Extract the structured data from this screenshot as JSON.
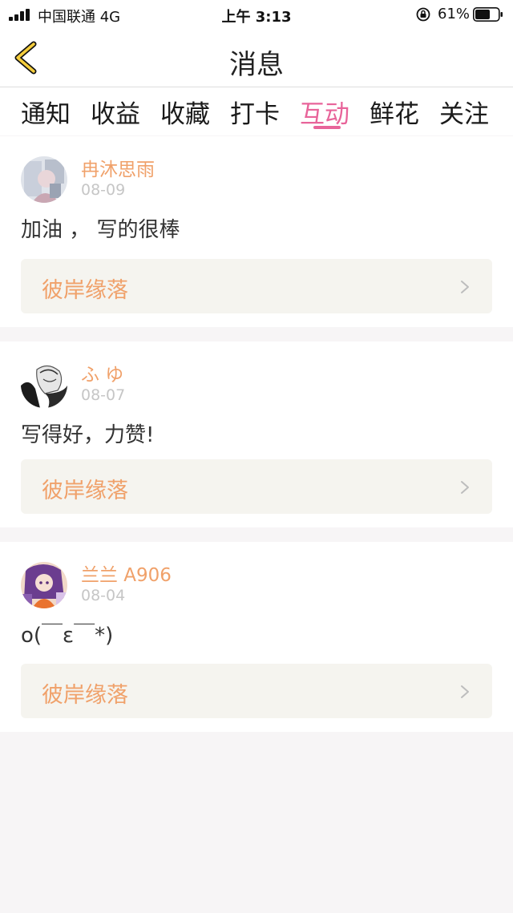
{
  "colors": {
    "accent": "#e8649a",
    "name": "#f0a16a",
    "link": "#f0a16a"
  },
  "statusbar": {
    "carrier": "中国联通  4G",
    "time": "上午 3:13",
    "battery": "61%"
  },
  "header": {
    "title": "消息",
    "back_icon": "chevron-left-icon"
  },
  "tabs": [
    {
      "label": "通知"
    },
    {
      "label": "收益"
    },
    {
      "label": "收藏"
    },
    {
      "label": "打卡"
    },
    {
      "label": "互动"
    },
    {
      "label": "鲜花"
    },
    {
      "label": "关注"
    }
  ],
  "active_tab": "互动",
  "messages": [
    {
      "user": "冉沐思雨",
      "date": "08-09",
      "text": "加油 ，  写的很棒",
      "link_title": "彼岸缘落"
    },
    {
      "user": "ふ ゆ",
      "date": "08-07",
      "text": "写得好，力赞!",
      "link_title": "彼岸缘落"
    },
    {
      "user": "兰兰 A906",
      "date": "08-04",
      "text": "o(￣ε￣*)",
      "link_title": "彼岸缘落"
    }
  ]
}
